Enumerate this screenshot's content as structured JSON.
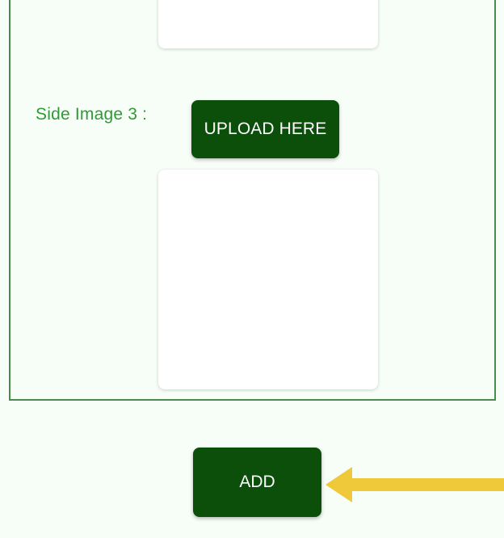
{
  "form": {
    "side_image_3_label": "Side Image 3 :",
    "upload_button_label": "UPLOAD HERE"
  },
  "actions": {
    "add_button_label": "ADD"
  },
  "annotation": {
    "arrow_color": "#f0c93a",
    "arrow_icon": "arrow-left-icon"
  },
  "colors": {
    "button_green": "#0b4f0b",
    "label_green": "#2f9a36",
    "border_green": "#4b8a4b",
    "background": "#f7fdf7"
  }
}
